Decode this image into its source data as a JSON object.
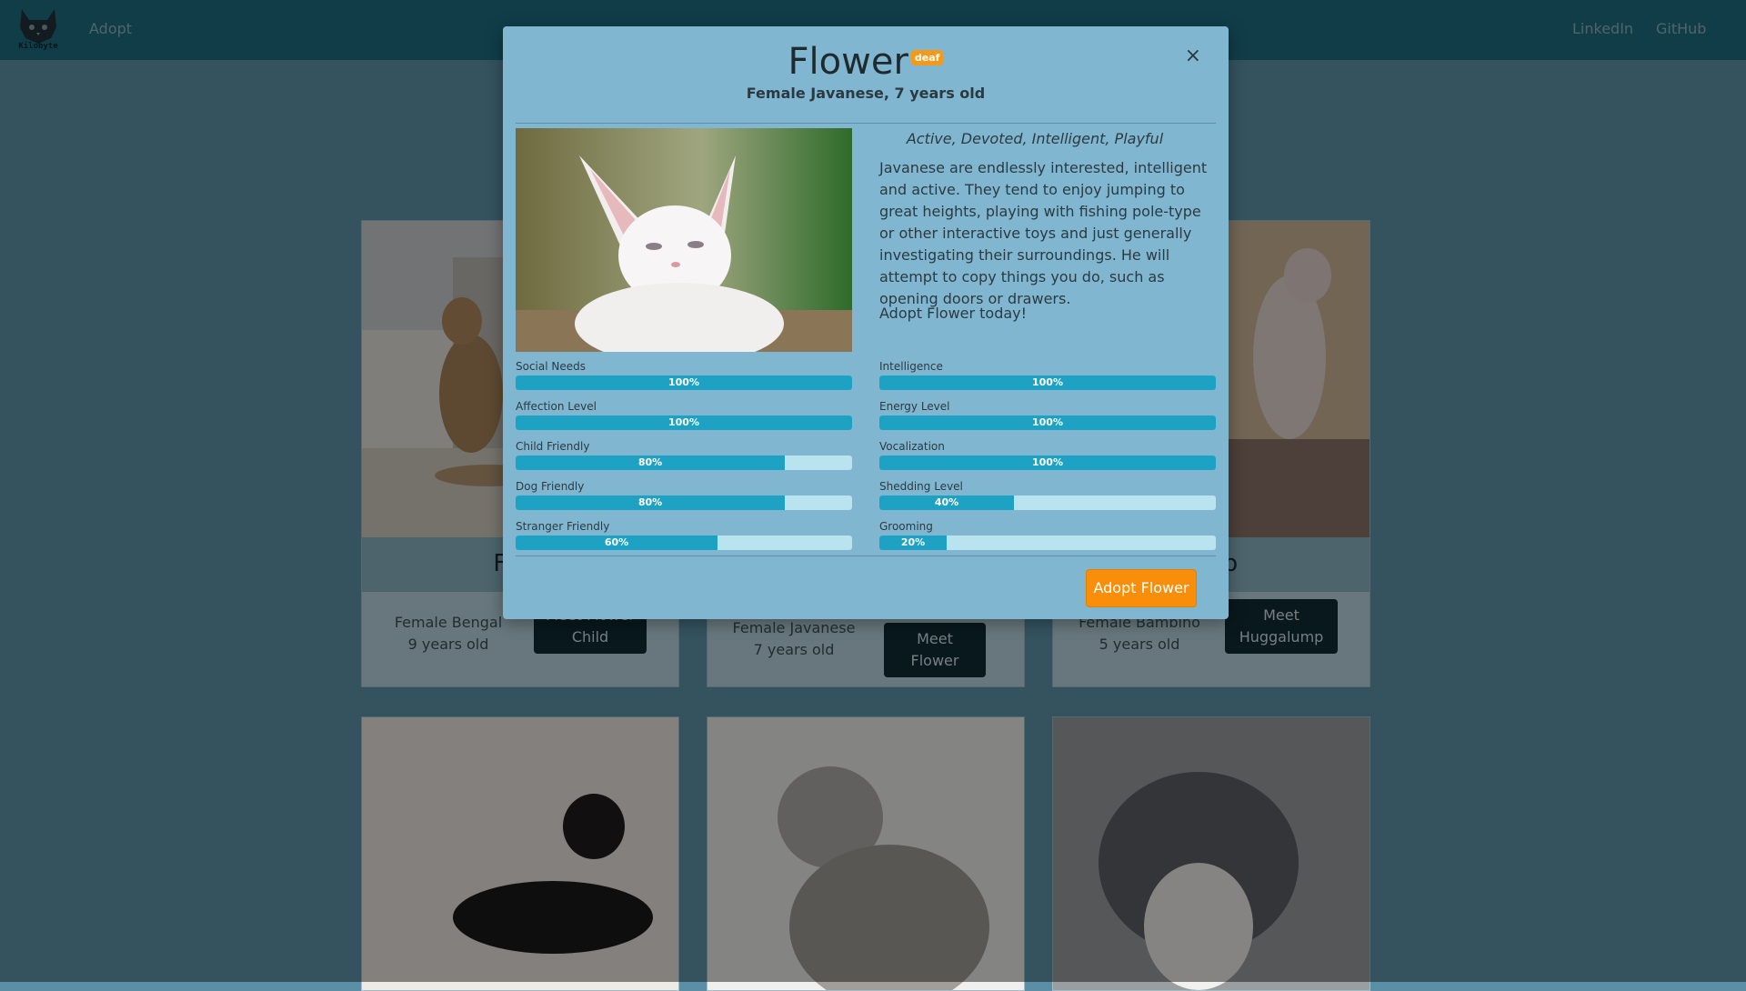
{
  "nav": {
    "logo_text": "Kilobyte",
    "adopt_link": "Adopt",
    "linkedin_link": "LinkedIn",
    "github_link": "GitHub"
  },
  "cards": [
    {
      "title": "Flow",
      "meta1": "Female Bengal",
      "meta2": "9 years old",
      "button": "Meet Flower Child"
    },
    {
      "title": "",
      "meta1": "Female Javanese",
      "meta2": "7 years old",
      "button": "Meet Flower"
    },
    {
      "title": "ump",
      "meta1": "Female Bambino",
      "meta2": "5 years old",
      "button": "Meet Huggalump"
    }
  ],
  "modal": {
    "close_symbol": "×",
    "name": "Flower",
    "badge": "deaf",
    "subtitle": "Female Javanese, 7 years old",
    "traits": "Active, Devoted, Intelligent, Playful",
    "description": "Javanese are endlessly interested, intelligent and active. They tend to enjoy jumping to great heights, playing with fishing pole-type or other interactive toys and just generally investigating their surroundings. He will attempt to copy things you do, such as opening doors or drawers.",
    "cta": "Adopt Flower today!",
    "adopt_button": "Adopt Flower",
    "stats_left": [
      {
        "label": "Social Needs",
        "value": 100,
        "text": "100%"
      },
      {
        "label": "Affection Level",
        "value": 100,
        "text": "100%"
      },
      {
        "label": "Child Friendly",
        "value": 80,
        "text": "80%"
      },
      {
        "label": "Dog Friendly",
        "value": 80,
        "text": "80%"
      },
      {
        "label": "Stranger Friendly",
        "value": 60,
        "text": "60%"
      }
    ],
    "stats_right": [
      {
        "label": "Intelligence",
        "value": 100,
        "text": "100%"
      },
      {
        "label": "Energy Level",
        "value": 100,
        "text": "100%"
      },
      {
        "label": "Vocalization",
        "value": 100,
        "text": "100%"
      },
      {
        "label": "Shedding Level",
        "value": 40,
        "text": "40%"
      },
      {
        "label": "Grooming",
        "value": 20,
        "text": "20%"
      }
    ]
  },
  "colors": {
    "accent": "#f98e0a",
    "progress": "#1ea2c4",
    "navbar": "#1e6f83",
    "modal": "#81b6d1"
  }
}
